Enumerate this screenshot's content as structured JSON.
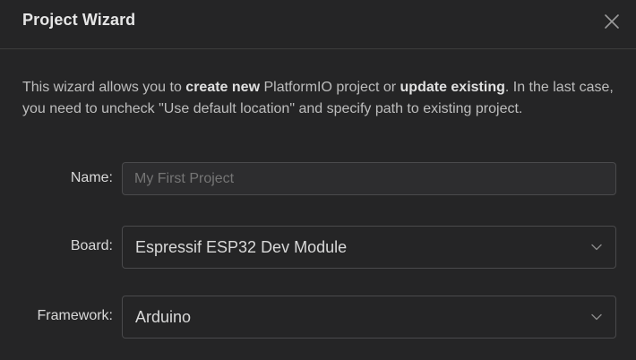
{
  "dialog": {
    "title": "Project Wizard",
    "close_icon": "close-icon"
  },
  "intro": {
    "part1": "This wizard allows you to ",
    "bold1": "create new",
    "part2": " PlatformIO project or ",
    "bold2": "update existing",
    "part3": ". In the last case, you need to uncheck \"Use default location\" and specify path to existing project."
  },
  "form": {
    "name": {
      "label": "Name",
      "value": "",
      "placeholder": "My First Project"
    },
    "board": {
      "label": "Board",
      "selected": "Espressif ESP32 Dev Module",
      "icon": "chevron-down-icon"
    },
    "framework": {
      "label": "Framework",
      "selected": "Arduino",
      "icon": "chevron-down-icon"
    },
    "label_suffix": ":"
  },
  "colors": {
    "background": "#252526",
    "border": "#4a4a4c",
    "text": "#d9d9d9"
  }
}
